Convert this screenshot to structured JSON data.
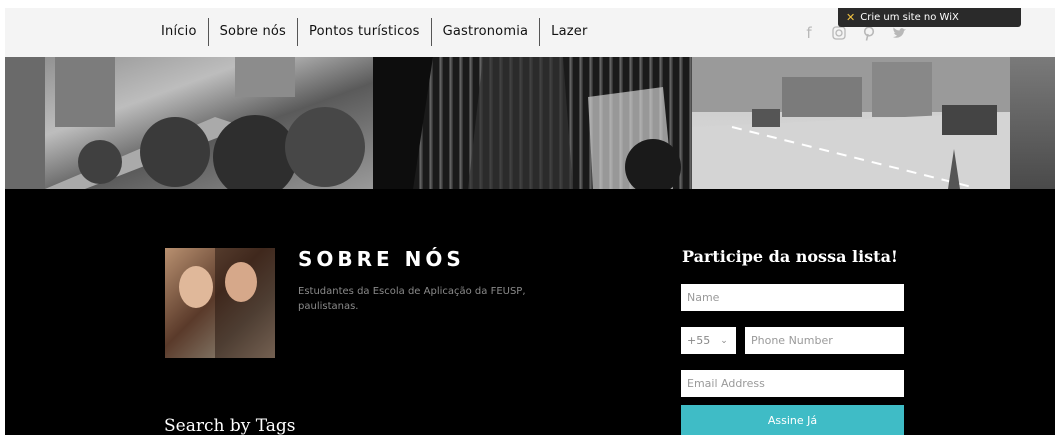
{
  "nav": {
    "items": [
      {
        "label": "Início"
      },
      {
        "label": "Sobre nós"
      },
      {
        "label": "Pontos turísticos"
      },
      {
        "label": "Gastronomia"
      },
      {
        "label": "Lazer"
      }
    ]
  },
  "social": {
    "icons": [
      "facebook-icon",
      "instagram-icon",
      "pinterest-icon",
      "twitter-icon"
    ],
    "glyphs": [
      "f",
      "◎",
      "℘",
      "🐦"
    ]
  },
  "wix_banner": {
    "label": "Crie um site no WiX"
  },
  "about": {
    "title": "SOBRE NÓS",
    "text": "Estudantes da Escola de Aplicação da FEUSP, paulistanas."
  },
  "tags": {
    "title": "Search by Tags"
  },
  "subscribe": {
    "title": "Participe da nossa lista!",
    "name_placeholder": "Name",
    "country_code": "+55",
    "phone_placeholder": "Phone Number",
    "email_placeholder": "Email Address",
    "submit_label": "Assine Já"
  },
  "colors": {
    "accent": "#3fbcc6",
    "background": "#000000",
    "header": "#f4f4f4"
  }
}
